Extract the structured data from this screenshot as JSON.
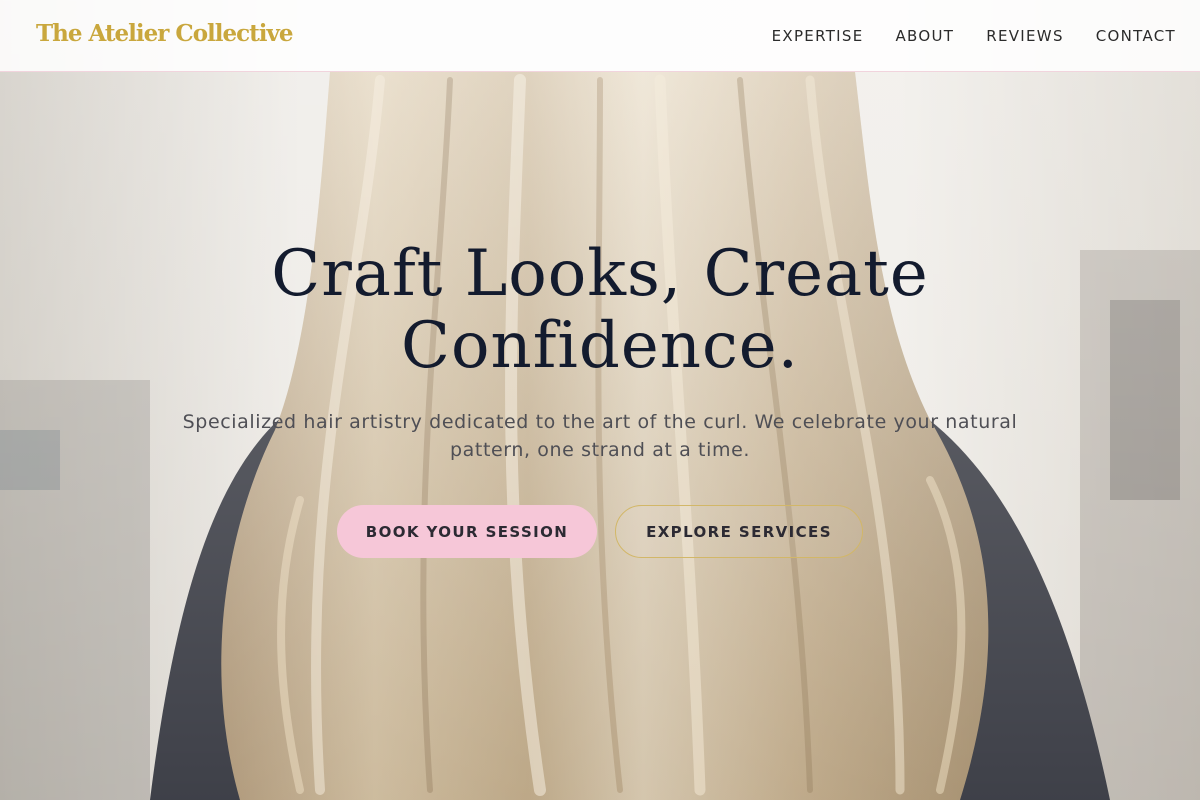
{
  "header": {
    "brand": "The Atelier Collective",
    "nav": [
      {
        "label": "EXPERTISE"
      },
      {
        "label": "ABOUT"
      },
      {
        "label": "REVIEWS"
      },
      {
        "label": "CONTACT"
      }
    ]
  },
  "hero": {
    "title": "Craft Looks, Create Confidence.",
    "subtitle": "Specialized hair artistry dedicated to the art of the curl. We celebrate your natural pattern, one strand at a time.",
    "primary_cta": "BOOK YOUR SESSION",
    "secondary_cta": "EXPLORE SERVICES",
    "image": "long blonde wavy hair viewed from behind, salon background"
  },
  "colors": {
    "brand_gold": "#c9a73d",
    "cta_pink": "#f6c7d8",
    "outline_gold": "#d2b768",
    "title_navy": "#131b2e"
  }
}
